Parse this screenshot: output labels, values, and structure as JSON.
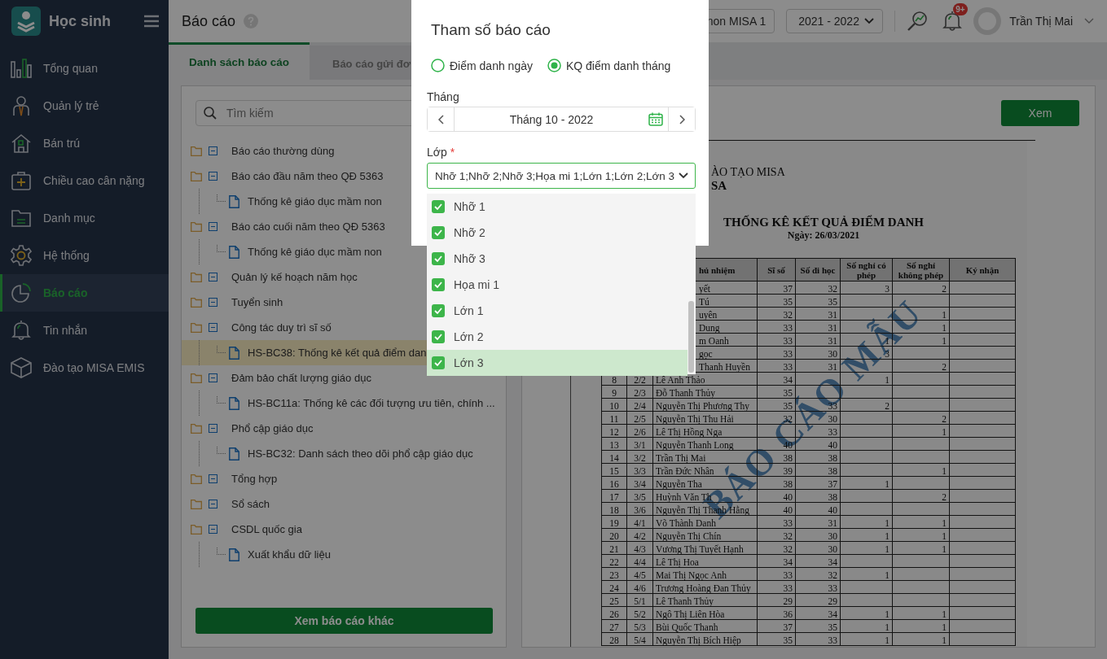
{
  "sidebar": {
    "app_title": "Học sinh",
    "items": [
      {
        "label": "Tổng quan",
        "selected": false
      },
      {
        "label": "Quản lý trẻ",
        "selected": false
      },
      {
        "label": "Bán trú",
        "selected": false
      },
      {
        "label": "Chiều cao cân nặng",
        "selected": false
      },
      {
        "label": "Danh mục",
        "selected": false
      },
      {
        "label": "Hệ thống",
        "selected": false
      },
      {
        "label": "Báo cáo",
        "selected": true
      },
      {
        "label": "Tin nhắn",
        "selected": false
      },
      {
        "label": "Đào tạo MISA EMIS",
        "selected": false
      }
    ]
  },
  "header": {
    "page_title": "Báo cáo",
    "school_select": "non MISA 1",
    "year_select": "2021 - 2022",
    "notification_badge": "9+",
    "user_name": "Trần Thị Mai"
  },
  "tabs": [
    {
      "label": "Danh sách báo cáo",
      "selected": true
    },
    {
      "label": "Báo cáo gửi đơ",
      "selected": false
    }
  ],
  "tree": {
    "search_placeholder": "Tìm kiếm",
    "groups": [
      {
        "label": "Báo cáo thường dùng",
        "expanded": true
      },
      {
        "label": "Báo cáo đầu năm theo QĐ 5363",
        "expanded": true,
        "children": [
          {
            "label": "Thống kê giáo dục mầm non",
            "selected": false
          }
        ]
      },
      {
        "label": "Báo cáo cuối năm theo QĐ 5363",
        "expanded": true,
        "children": [
          {
            "label": "Thống kê giáo dục mầm non",
            "selected": false
          }
        ]
      },
      {
        "label": "Quản lý kế hoạch năm học",
        "expanded": true
      },
      {
        "label": "Tuyển sinh",
        "expanded": true
      },
      {
        "label": "Công tác duy trì sĩ số",
        "expanded": true,
        "children": [
          {
            "label": "HS-BC38: Thống kê kết quả điểm dan",
            "selected": true
          }
        ]
      },
      {
        "label": "Đảm bảo chất lượng giáo dục",
        "expanded": true,
        "children": [
          {
            "label": "HS-BC11a: Thống kê các đối tượng ưu tiên, chính ...",
            "selected": false
          }
        ]
      },
      {
        "label": "Phổ cập giáo dục",
        "expanded": true,
        "children": [
          {
            "label": "HS-BC32: Danh sách theo dõi phổ cập giáo dục",
            "selected": false
          }
        ]
      },
      {
        "label": "Tổng hợp",
        "expanded": true
      },
      {
        "label": "Sổ sách",
        "expanded": true
      },
      {
        "label": "CSDL quốc gia",
        "expanded": true,
        "children": [
          {
            "label": "Xuất khẩu dữ liệu",
            "selected": false
          }
        ]
      }
    ],
    "more_button": "Xem báo cáo khác"
  },
  "report": {
    "view_button": "Xem",
    "org_line_1": "ÀO TẠO MISA",
    "org_line_2": "SA",
    "title": "THỐNG KÊ KẾT QUẢ ĐIỂM DANH",
    "date": "Ngày: 26/03/2021",
    "stamp": "BÁO CÁO MẪU",
    "columns": [
      "",
      "",
      "hủ nhiệm",
      "Sĩ số",
      "Số đi học",
      "Số nghỉ có phép",
      "Số nghỉ không phép",
      "Ký nhận"
    ],
    "rows": [
      [
        null,
        null,
        "yết",
        "37",
        "32",
        "3",
        "2"
      ],
      [
        null,
        null,
        "Tú",
        "35",
        "35",
        null,
        null
      ],
      [
        null,
        null,
        "uyên",
        "32",
        "31",
        null,
        "1"
      ],
      [
        null,
        null,
        "Dung",
        "33",
        "31",
        null,
        "1"
      ],
      [
        null,
        null,
        "m Oanh",
        "33",
        "31",
        "1",
        "1"
      ],
      [
        null,
        null,
        "gọc",
        "33",
        "30",
        "3",
        null
      ],
      [
        null,
        null,
        "Thanh Huyền",
        "33",
        "31",
        null,
        "2"
      ],
      [
        "8",
        "2/2",
        "Lê Anh Thảo",
        "34",
        null,
        "1",
        null
      ],
      [
        "9",
        "2/3",
        "Đỗ Thanh Thủy",
        "35",
        null,
        null,
        null
      ],
      [
        "10",
        "2/4",
        "Nguyễn Thị Phương Thy",
        "35",
        "33",
        "2",
        null
      ],
      [
        "11",
        "2/5",
        "Nguyễn Thị Thu Hải",
        "32",
        "30",
        null,
        "2"
      ],
      [
        "12",
        "2/6",
        "Lê Thị Hồng Nga",
        null,
        "33",
        null,
        "1"
      ],
      [
        "13",
        "3/1",
        "Nguyễn Thanh Long",
        "40",
        "40",
        null,
        null
      ],
      [
        "14",
        "3/2",
        "Trần Thị Mai",
        "38",
        "38",
        null,
        null
      ],
      [
        "15",
        "3/3",
        "Trần Đức Nhân",
        "39",
        "38",
        null,
        "1"
      ],
      [
        "16",
        "3/4",
        "Nguyễn Tha",
        "38",
        "37",
        "1",
        null
      ],
      [
        "17",
        "3/5",
        "Huỳnh Văn Th",
        "40",
        "38",
        null,
        "2"
      ],
      [
        "18",
        "3/6",
        "Nguyễn Thị Thanh Hằng",
        "40",
        "40",
        null,
        null
      ],
      [
        "19",
        "4/1",
        "Võ Thành Danh",
        "33",
        "31",
        "1",
        "1"
      ],
      [
        "20",
        "4/2",
        "Nguyễn Thị Chín",
        "32",
        "30",
        "1",
        "1"
      ],
      [
        "21",
        "4/3",
        "Vương Thị Tuyết Hạnh",
        "32",
        "30",
        "1",
        "1"
      ],
      [
        "22",
        "4/4",
        "Lê Thị Hoa",
        "34",
        "34",
        null,
        null
      ],
      [
        "23",
        "4/5",
        "Mai Thị Ngọc Anh",
        "33",
        "32",
        "1",
        null
      ],
      [
        "24",
        "4/6",
        "Trương Hoàng Đan Thủy",
        "33",
        "33",
        null,
        null
      ],
      [
        "25",
        "5/1",
        "Lê Thanh Thủy",
        "29",
        "29",
        null,
        null
      ],
      [
        "26",
        "5/2",
        "Ngô Thị Liên Hòa",
        "36",
        "34",
        "1",
        "1"
      ],
      [
        "27",
        "5/3",
        "Bùi Quốc Thanh",
        "37",
        "35",
        "1",
        "1"
      ],
      [
        "28",
        "5/4",
        "Nguyễn Thị Bích Hiệp",
        "35",
        "33",
        "1",
        "1"
      ]
    ]
  },
  "dialog": {
    "title": "Tham số báo cáo",
    "radios": [
      {
        "label": "Điểm danh ngày",
        "selected": false
      },
      {
        "label": "KQ điểm danh tháng",
        "selected": true
      }
    ],
    "month_label": "Tháng",
    "month_value": "Tháng 10 - 2022",
    "class_label": "Lớp",
    "required_mark": "*",
    "class_value": "Nhỡ 1;Nhỡ 2;Nhỡ 3;Họa mi 1;Lớn 1;Lớn 2;Lớn 3",
    "class_options": [
      {
        "label": "Nhỡ 1",
        "checked": true,
        "highlighted": false
      },
      {
        "label": "Nhỡ 2",
        "checked": true,
        "highlighted": false
      },
      {
        "label": "Nhỡ 3",
        "checked": true,
        "highlighted": false
      },
      {
        "label": "Họa mi 1",
        "checked": true,
        "highlighted": false
      },
      {
        "label": "Lớn 1",
        "checked": true,
        "highlighted": false
      },
      {
        "label": "Lớn 2",
        "checked": true,
        "highlighted": false
      },
      {
        "label": "Lớn 3",
        "checked": true,
        "highlighted": true
      }
    ]
  }
}
